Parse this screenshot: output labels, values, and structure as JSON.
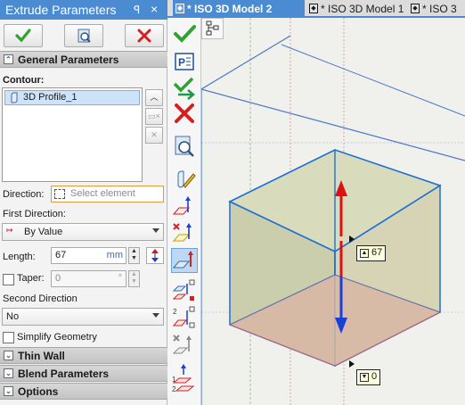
{
  "panel": {
    "title": "Extrude Parameters",
    "pin_glyph": "ꟼ",
    "close_glyph": "×",
    "buttons": {
      "ok_icon": "checkmark-icon",
      "preview_icon": "preview-icon",
      "cancel_icon": "cancel-x-icon"
    },
    "general_section": "General Parameters",
    "contour_label": "Contour:",
    "contour_items": [
      "3D Profile_1"
    ],
    "direction_label": "Direction:",
    "direction_placeholder": "Select element",
    "first_direction_label": "First Direction:",
    "first_direction_value": "By Value",
    "length_label": "Length:",
    "length_value": "67",
    "length_unit": "mm",
    "taper_label": "Taper:",
    "taper_value": "0",
    "taper_unit": "°",
    "second_direction_label": "Second Direction",
    "second_direction_value": "No",
    "simplify_label": "Simplify Geometry",
    "thin_wall_section": "Thin Wall",
    "blend_section": "Blend Parameters",
    "options_section": "Options"
  },
  "tabs": [
    {
      "label": "* ISO 3D Model 2",
      "active": true
    },
    {
      "label": "* ISO 3D Model 1",
      "active": false
    },
    {
      "label": "* ISO 3",
      "active": false
    }
  ],
  "viewport": {
    "dim_top": "67",
    "dim_bottom": "0"
  },
  "colors": {
    "accent": "#4a8bd1",
    "ok_green": "#2ea32e",
    "cancel_red": "#d42020",
    "arrow_red": "#e01010",
    "arrow_blue": "#1a3fd6"
  }
}
